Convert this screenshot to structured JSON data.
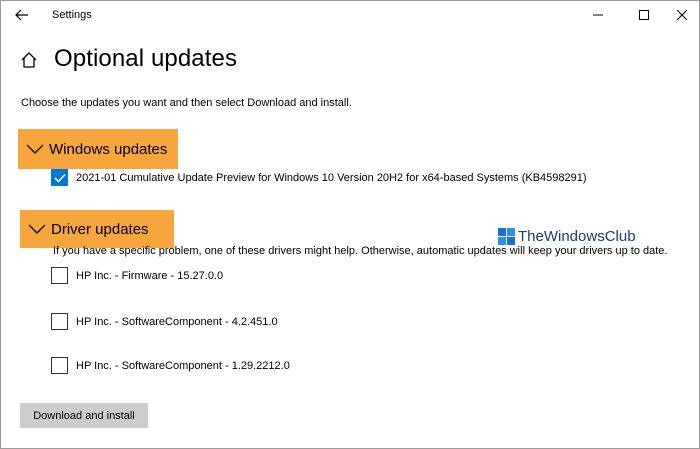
{
  "window": {
    "title": "Settings",
    "controls": [
      "minimize",
      "maximize",
      "close"
    ]
  },
  "header": {
    "title": "Optional updates"
  },
  "intro": "Choose the updates you want and then select Download and install.",
  "sections": {
    "windows": {
      "label": "Windows updates",
      "items": [
        {
          "label": "2021-01 Cumulative Update Preview for Windows 10 Version 20H2 for x64-based Systems (KB4598291)",
          "checked": true
        }
      ]
    },
    "driver": {
      "label": "Driver updates",
      "description": "If you have a specific problem, one of these drivers might help. Otherwise, automatic updates will keep your drivers up to date.",
      "items": [
        {
          "label": "HP Inc. - Firmware - 15.27.0.0",
          "checked": false
        },
        {
          "label": "HP Inc. - SoftwareComponent - 4.2.451.0",
          "checked": false
        },
        {
          "label": "HP Inc. - SoftwareComponent - 1.29.2212.0",
          "checked": false
        }
      ]
    }
  },
  "watermark": {
    "text": "TheWindowsClub"
  },
  "actions": {
    "download_label": "Download and install"
  },
  "colors": {
    "highlight": "#f6a63c",
    "accent": "#0078d7",
    "button_bg": "#cccccc",
    "watermark_text": "#1a3e6e"
  },
  "icons": [
    "back-arrow-icon",
    "minimize-icon",
    "maximize-icon",
    "close-icon",
    "home-icon",
    "chevron-down-icon",
    "checkmark-icon",
    "windows-logo-icon"
  ]
}
